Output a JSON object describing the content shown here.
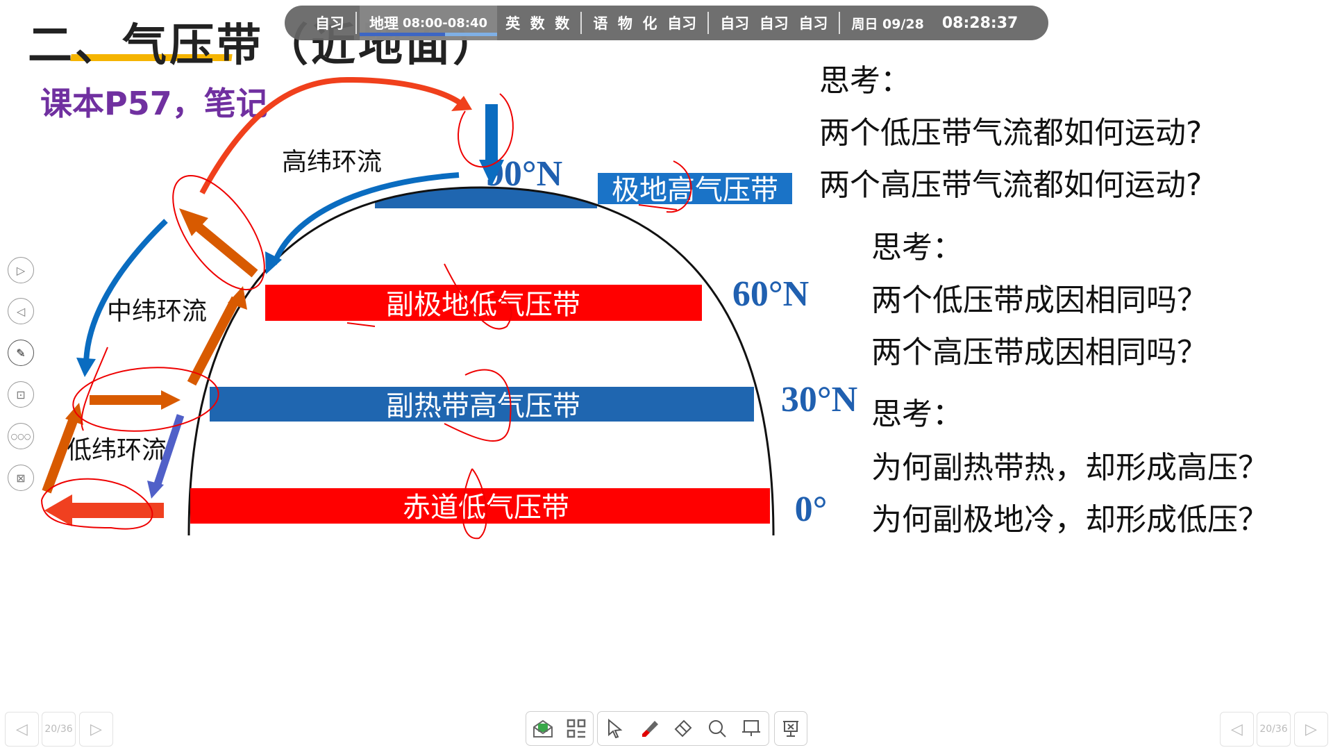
{
  "slide": {
    "title": "二、气压带（近地面）",
    "subtitle": "课本P57，笔记"
  },
  "schedule_bar": {
    "items": [
      "自习"
    ],
    "current": {
      "label": "地理",
      "time": "08:00-08:40",
      "progress": 0.62
    },
    "group2": "英  数  数",
    "group3": "语  物  化  自习",
    "group4": "自习  自习  自习",
    "date": "周日 09/28",
    "clock": "08:28:37"
  },
  "diagram": {
    "circulations": {
      "high": "高纬环流",
      "mid": "中纬环流",
      "low": "低纬环流"
    },
    "belts": {
      "polar_high": "极地高气压带",
      "subpolar_low": "副极地低气压带",
      "subtropical_high": "副热带高气压带",
      "equatorial_low": "赤道低气压带"
    },
    "latitudes": {
      "lat90": "90°N",
      "lat60": "60°N",
      "lat30": "30°N",
      "lat0": "0°"
    },
    "colors": {
      "low": "#ff0000",
      "high": "#1f66b0",
      "arrow_orange": "#d85a00",
      "arrow_blue": "#0a6cc0",
      "annotation": "#ee0000"
    }
  },
  "questions": {
    "block1": {
      "heading": "思考：",
      "lines": [
        "两个低压带气流都如何运动?",
        "两个高压带气流都如何运动?"
      ]
    },
    "block2": {
      "heading": "思考：",
      "lines": [
        "两个低压带成因相同吗？",
        "两个高压带成因相同吗？"
      ]
    },
    "block3": {
      "heading": "思考：",
      "lines": [
        "为何副热带热，却形成高压？",
        "为何副极地冷，却形成低压？"
      ]
    }
  },
  "side_tools": [
    "next-icon",
    "prev-icon",
    "pen-icon",
    "screenshot-icon",
    "more-icon",
    "exit-icon"
  ],
  "pager": {
    "left": "20/36",
    "right": "20/36"
  },
  "toolbar": [
    "message-icon",
    "apps-icon",
    "select-icon",
    "pen-icon",
    "eraser-icon",
    "zoom-icon",
    "whiteboard-icon",
    "end-show-icon"
  ]
}
